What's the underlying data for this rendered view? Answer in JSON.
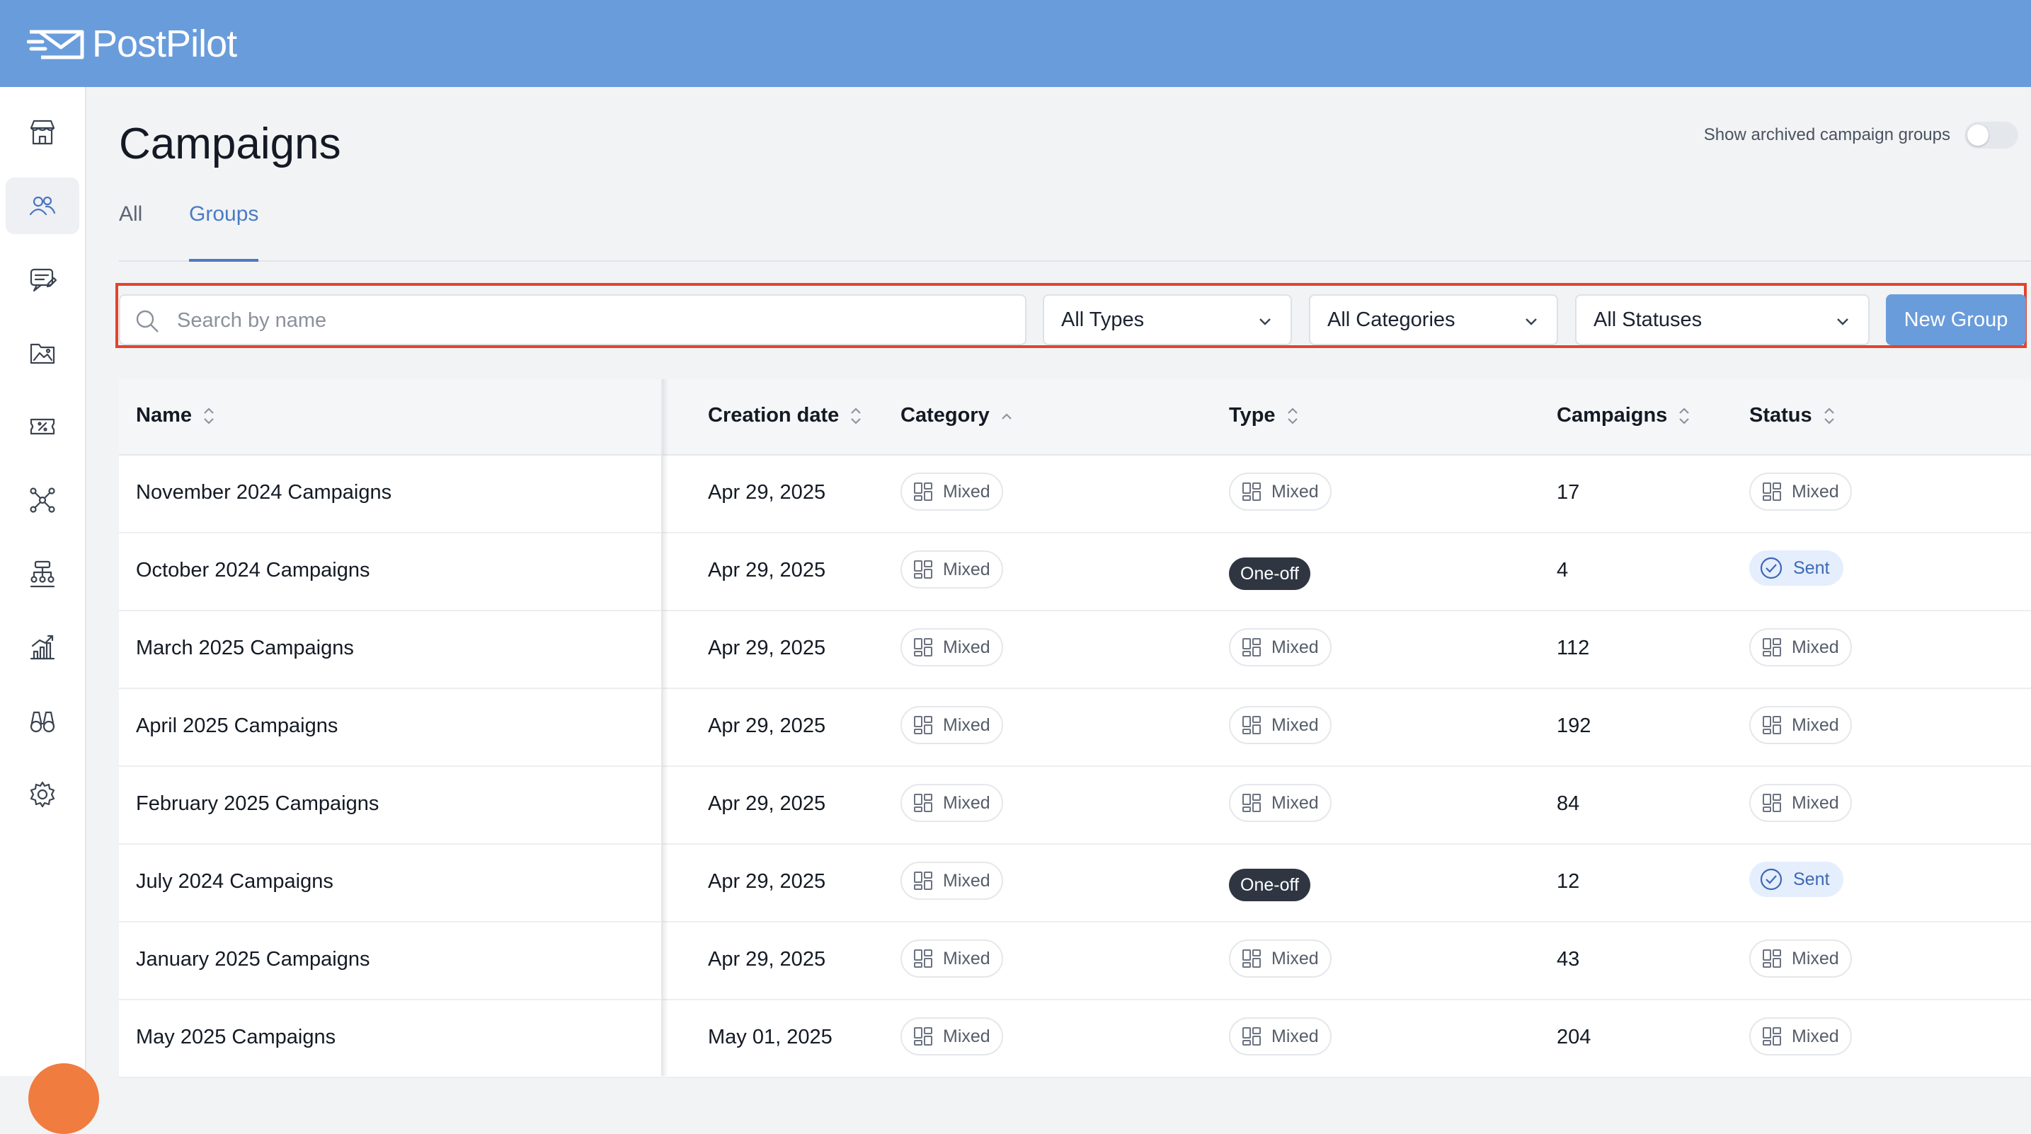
{
  "app": {
    "logo_text": "PostPilot",
    "accent": "#699cdb"
  },
  "sidebar": {
    "items": [
      {
        "icon": "storefront-icon",
        "active": false
      },
      {
        "icon": "users-icon",
        "active": true
      },
      {
        "icon": "message-icon",
        "active": false
      },
      {
        "icon": "image-folder-icon",
        "active": false
      },
      {
        "icon": "discount-ticket-icon",
        "active": false
      },
      {
        "icon": "network-icon",
        "active": false
      },
      {
        "icon": "flow-icon",
        "active": false
      },
      {
        "icon": "analytics-icon",
        "active": false
      },
      {
        "icon": "binoculars-icon",
        "active": false
      },
      {
        "icon": "gear-icon",
        "active": false
      }
    ]
  },
  "page": {
    "title": "Campaigns",
    "archived_toggle_label": "Show archived campaign groups",
    "archived_toggle_on": false
  },
  "tabs": [
    {
      "label": "All",
      "active": false
    },
    {
      "label": "Groups",
      "active": true
    }
  ],
  "filters": {
    "search_placeholder": "Search by name",
    "types": "All Types",
    "categories": "All Categories",
    "statuses": "All Statuses",
    "new_group": "New Group"
  },
  "table": {
    "headers": {
      "name": "Name",
      "creation_date": "Creation date",
      "category": "Category",
      "type": "Type",
      "campaigns": "Campaigns",
      "status": "Status"
    },
    "rows": [
      {
        "name": "November 2024 Campaigns",
        "date": "Apr 29, 2025",
        "category": "Mixed",
        "type": "Mixed",
        "campaigns": "17",
        "status": "Mixed"
      },
      {
        "name": "October 2024 Campaigns",
        "date": "Apr 29, 2025",
        "category": "Mixed",
        "type": "One-off",
        "campaigns": "4",
        "status": "Sent"
      },
      {
        "name": "March 2025 Campaigns",
        "date": "Apr 29, 2025",
        "category": "Mixed",
        "type": "Mixed",
        "campaigns": "112",
        "status": "Mixed"
      },
      {
        "name": "April 2025 Campaigns",
        "date": "Apr 29, 2025",
        "category": "Mixed",
        "type": "Mixed",
        "campaigns": "192",
        "status": "Mixed"
      },
      {
        "name": "February 2025 Campaigns",
        "date": "Apr 29, 2025",
        "category": "Mixed",
        "type": "Mixed",
        "campaigns": "84",
        "status": "Mixed"
      },
      {
        "name": "July 2024 Campaigns",
        "date": "Apr 29, 2025",
        "category": "Mixed",
        "type": "One-off",
        "campaigns": "12",
        "status": "Sent"
      },
      {
        "name": "January 2025 Campaigns",
        "date": "Apr 29, 2025",
        "category": "Mixed",
        "type": "Mixed",
        "campaigns": "43",
        "status": "Mixed"
      },
      {
        "name": "May 2025 Campaigns",
        "date": "May 01, 2025",
        "category": "Mixed",
        "type": "Mixed",
        "campaigns": "204",
        "status": "Mixed"
      }
    ]
  }
}
